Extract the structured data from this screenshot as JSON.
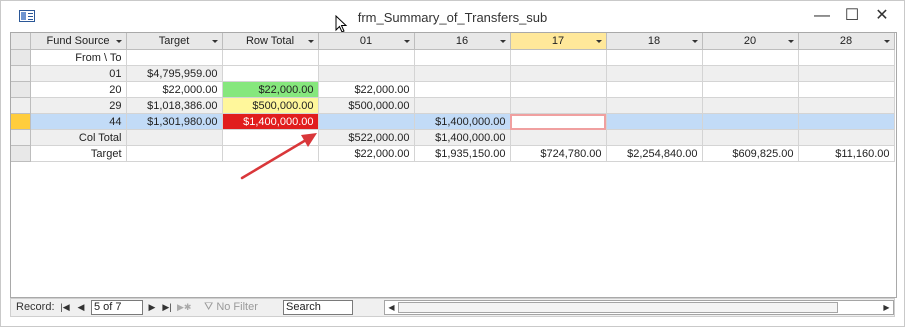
{
  "window": {
    "title": "frm_Summary_of_Transfers_sub",
    "icon": "form-icon",
    "minimize": "—",
    "maximize": "☐",
    "close": "✕"
  },
  "columns": [
    {
      "label": "Fund Source"
    },
    {
      "label": "Target"
    },
    {
      "label": "Row Total"
    },
    {
      "label": "01"
    },
    {
      "label": "16"
    },
    {
      "label": "17"
    },
    {
      "label": "18"
    },
    {
      "label": "20"
    },
    {
      "label": "28"
    }
  ],
  "rows": [
    {
      "cells": [
        "From \\ To",
        "",
        "",
        "",
        "",
        "",
        "",
        "",
        ""
      ]
    },
    {
      "cells": [
        "01",
        "$4,795,959.00",
        "",
        "",
        "",
        "",
        "",
        "",
        ""
      ]
    },
    {
      "cells": [
        "20",
        "$22,000.00",
        "$22,000.00",
        "$22,000.00",
        "",
        "",
        "",
        "",
        ""
      ]
    },
    {
      "cells": [
        "29",
        "$1,018,386.00",
        "$500,000.00",
        "$500,000.00",
        "",
        "",
        "",
        "",
        ""
      ]
    },
    {
      "cells": [
        "44",
        "$1,301,980.00",
        "$1,400,000.00",
        "",
        "$1,400,000.00",
        "",
        "",
        "",
        ""
      ]
    },
    {
      "cells": [
        "Col Total",
        "",
        "",
        "$522,000.00",
        "$1,400,000.00",
        "",
        "",
        "",
        ""
      ]
    },
    {
      "cells": [
        "Target",
        "",
        "",
        "$22,000.00",
        "$1,935,150.00",
        "$724,780.00",
        "$2,254,840.00",
        "$609,825.00",
        "$11,160.00"
      ]
    }
  ],
  "navigation": {
    "record_label": "Record:",
    "record_value": "5 of 7",
    "no_filter_label": "No Filter",
    "search_placeholder": "Search",
    "first_icon": "first-record-icon",
    "prev_icon": "previous-record-icon",
    "next_icon": "next-record-icon",
    "last_icon": "last-record-icon",
    "new_icon": "new-record-icon"
  },
  "colors": {
    "selected_row": "#c2dbf7",
    "current_col_header": "#ffe89a",
    "green": "#86e77d",
    "yellow": "#fff79b",
    "red": "#e11d1d",
    "arrow": "#d9373a"
  }
}
